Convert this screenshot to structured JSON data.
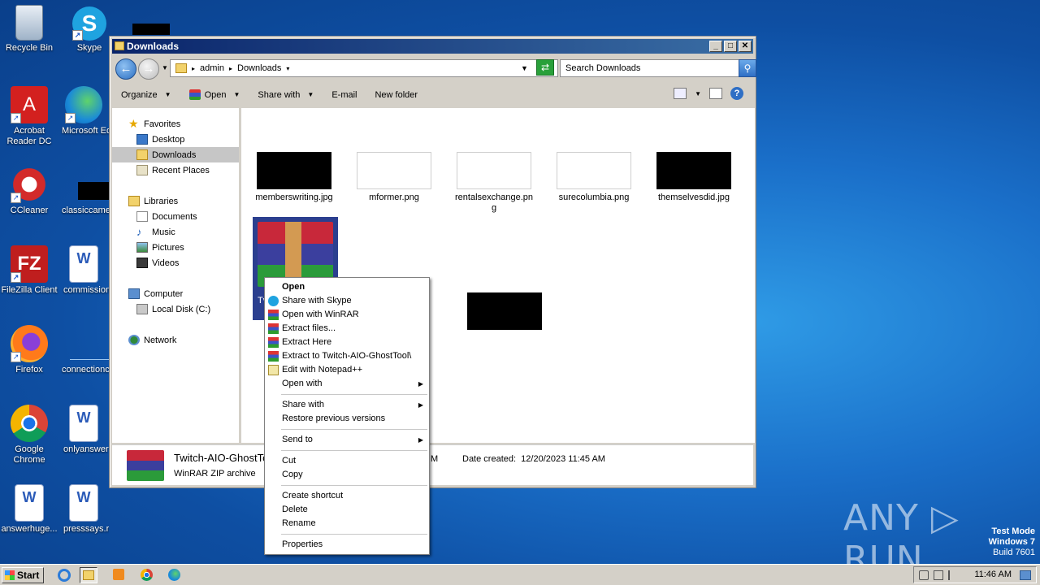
{
  "desktop": {
    "icons": [
      {
        "label": "Recycle Bin"
      },
      {
        "label": "Skype"
      },
      {
        "label": "Acrobat Reader DC"
      },
      {
        "label": "Microsoft Ed"
      },
      {
        "label": "CCleaner"
      },
      {
        "label": "classiccame"
      },
      {
        "label": "FileZilla Client"
      },
      {
        "label": "commission"
      },
      {
        "label": "Firefox"
      },
      {
        "label": "connectionc"
      },
      {
        "label": "Google Chrome"
      },
      {
        "label": "onlyanswer"
      },
      {
        "label": "answerhuge..."
      },
      {
        "label": "presssays.rtf"
      }
    ]
  },
  "window": {
    "title": "Downloads",
    "address": {
      "crumbs": [
        "admin",
        "Downloads"
      ]
    },
    "search_placeholder": "Search Downloads",
    "toolbar": {
      "organize": "Organize",
      "open": "Open",
      "share_with": "Share with",
      "email": "E-mail",
      "new_folder": "New folder"
    },
    "nav": {
      "favorites": "Favorites",
      "desktop": "Desktop",
      "downloads": "Downloads",
      "recent_places": "Recent Places",
      "libraries": "Libraries",
      "documents": "Documents",
      "music": "Music",
      "pictures": "Pictures",
      "videos": "Videos",
      "computer": "Computer",
      "local_disk": "Local Disk (C:)",
      "network": "Network"
    },
    "files": [
      {
        "name": "memberswriting.jpg"
      },
      {
        "name": "mformer.png"
      },
      {
        "name": "rentalsexchange.png"
      },
      {
        "name": "surecolumbia.png"
      },
      {
        "name": "themselvesdid.jpg"
      },
      {
        "name": "Tv"
      }
    ],
    "details": {
      "name": "Twitch-AIO-GhostTo",
      "type": "WinRAR ZIP archive",
      "modified_tail": "M",
      "date_created_label": "Date created:",
      "date_created": "12/20/2023 11:45 AM"
    }
  },
  "context_menu": {
    "open": "Open",
    "share_skype": "Share with Skype",
    "open_winrar": "Open with WinRAR",
    "extract_files": "Extract files...",
    "extract_here": "Extract Here",
    "extract_to": "Extract to Twitch-AIO-GhostTool\\",
    "edit_notepad": "Edit with Notepad++",
    "open_with": "Open with",
    "share_with": "Share with",
    "restore": "Restore previous versions",
    "send_to": "Send to",
    "cut": "Cut",
    "copy": "Copy",
    "create_shortcut": "Create shortcut",
    "delete": "Delete",
    "rename": "Rename",
    "properties": "Properties"
  },
  "taskbar": {
    "start": "Start",
    "clock": "11:46 AM"
  },
  "watermark": {
    "line1": "Test Mode",
    "line2": "Windows 7",
    "line3": "Build 7601",
    "brand": "ANY ▷ RUN"
  }
}
